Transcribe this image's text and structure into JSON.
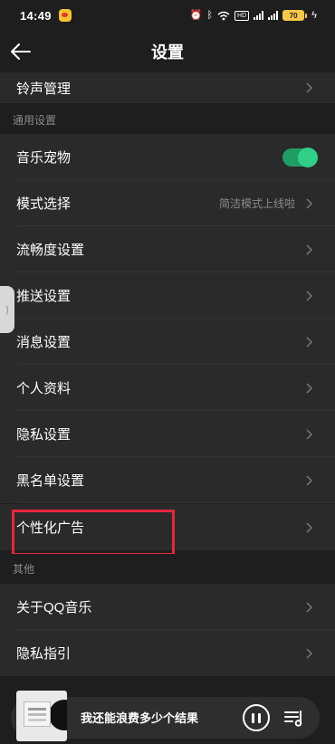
{
  "status_bar": {
    "time": "14:49",
    "battery": "70",
    "network_tag": "HD"
  },
  "header": {
    "title": "设置"
  },
  "rows_top": [
    {
      "label": "铃声管理"
    }
  ],
  "section_general": {
    "title": "通用设置",
    "items": [
      {
        "label": "音乐宠物",
        "toggle": true
      },
      {
        "label": "模式选择",
        "value": "简洁模式上线啦"
      },
      {
        "label": "流畅度设置"
      },
      {
        "label": "推送设置"
      },
      {
        "label": "消息设置"
      },
      {
        "label": "个人资料"
      },
      {
        "label": "隐私设置"
      },
      {
        "label": "黑名单设置"
      },
      {
        "label": "个性化广告"
      }
    ]
  },
  "section_other": {
    "title": "其他",
    "items": [
      {
        "label": "关于QQ音乐"
      },
      {
        "label": "隐私指引"
      }
    ]
  },
  "player": {
    "song": "我还能浪费多少个结果"
  },
  "colors": {
    "background": "#1e1e1e",
    "row": "#2a2a2a",
    "accent_green": "#31d089",
    "highlight_red": "#e8263e"
  }
}
